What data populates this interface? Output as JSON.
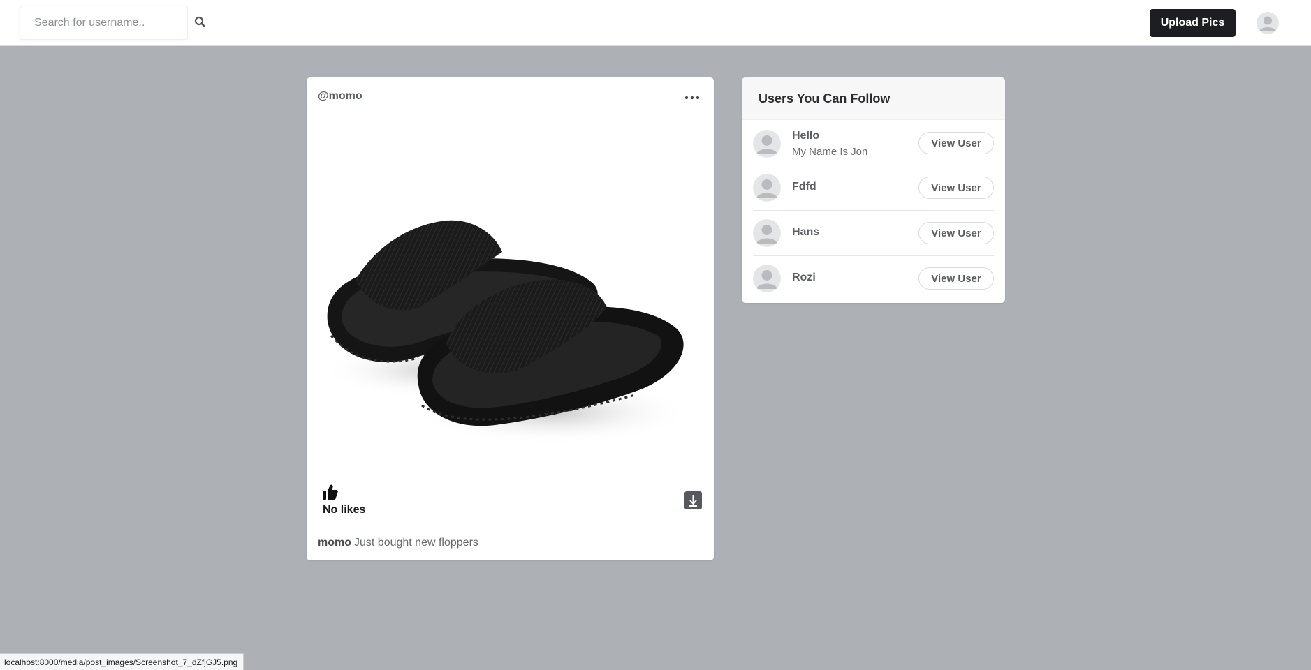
{
  "nav": {
    "search_placeholder": "Search for username..",
    "upload_label": "Upload Pics",
    "icons": {
      "search": "search-icon",
      "avatar": "user-avatar-icon"
    }
  },
  "post": {
    "username": "@momo",
    "image_alt": "post-image-slippers",
    "likes_text": "No likes",
    "caption_user": "momo",
    "caption_text": "Just bought new floppers",
    "icons": {
      "menu": "more-horizontal-icon",
      "like": "thumbs-up-icon",
      "download": "download-icon"
    }
  },
  "suggestions": {
    "title": "Users You Can Follow",
    "users": [
      {
        "name": "Hello",
        "bio": "My Name Is Jon",
        "button": "View User"
      },
      {
        "name": "Fdfd",
        "bio": "",
        "button": "View User"
      },
      {
        "name": "Hans",
        "bio": "",
        "button": "View User"
      },
      {
        "name": "Rozi",
        "bio": "",
        "button": "View User"
      }
    ]
  },
  "status_bar": {
    "url": "localhost:8000/media/post_images/Screenshot_7_dZfjGJ5.png"
  },
  "colors": {
    "page_bg": "#adb0b4",
    "card_bg": "#ffffff",
    "primary_button": "#1c1e22"
  }
}
